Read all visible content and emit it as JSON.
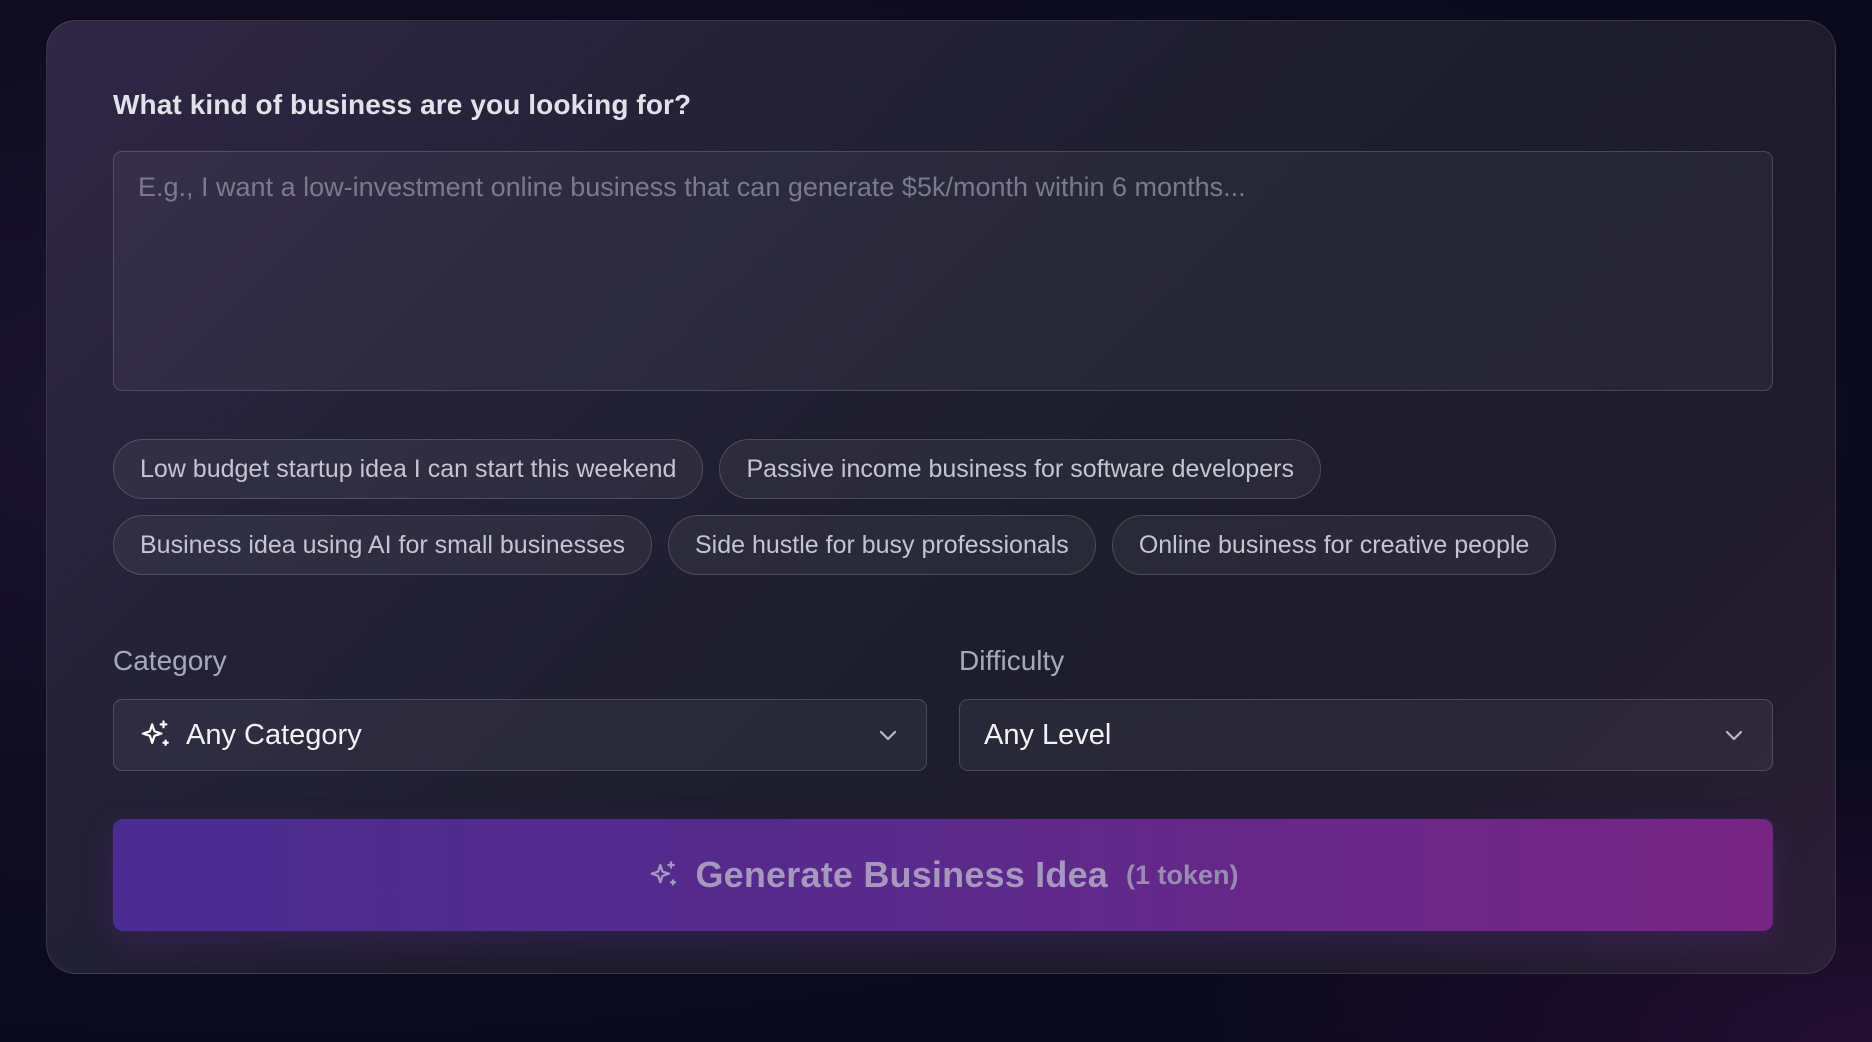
{
  "form": {
    "question_label": "What kind of business are you looking for?",
    "prompt_value": "",
    "prompt_placeholder": "E.g., I want a low-investment online business that can generate $5k/month within 6 months..."
  },
  "suggestions": [
    "Low budget startup idea I can start this weekend",
    "Passive income business for software developers",
    "Business idea using AI for small businesses",
    "Side hustle for busy professionals",
    "Online business for creative people"
  ],
  "category": {
    "label": "Category",
    "selected": "Any Category",
    "icon": "sparkles-icon"
  },
  "difficulty": {
    "label": "Difficulty",
    "selected": "Any Level"
  },
  "generate": {
    "label": "Generate Business Idea",
    "token_cost": "(1 token)",
    "icon": "sparkles-icon"
  },
  "colors": {
    "button_gradient_start": "#4a2c92",
    "button_gradient_end": "#772583",
    "card_bg": "#1d1d2c"
  }
}
